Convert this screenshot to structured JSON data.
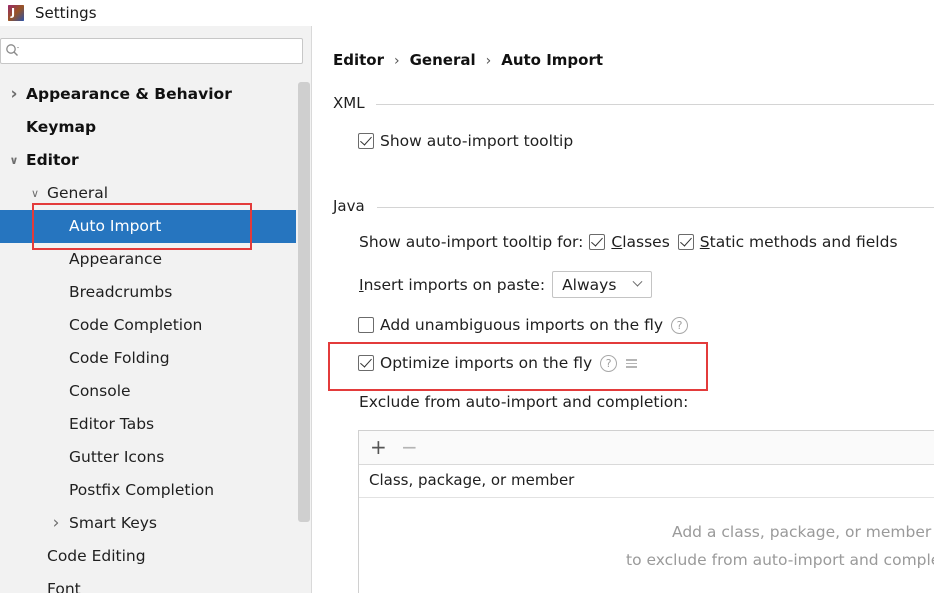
{
  "window": {
    "title": "Settings",
    "app_icon_letter": "J"
  },
  "search": {
    "placeholder": "",
    "value": ""
  },
  "tree": [
    {
      "label": "Appearance & Behavior",
      "bold": true,
      "indent": 0,
      "chevron": "collapsed",
      "name": "tree-item-appearance-behavior"
    },
    {
      "label": "Keymap",
      "bold": true,
      "indent": 0,
      "chevron": "none",
      "name": "tree-item-keymap"
    },
    {
      "label": "Editor",
      "bold": true,
      "indent": 0,
      "chevron": "expanded",
      "name": "tree-item-editor"
    },
    {
      "label": "General",
      "bold": false,
      "indent": 1,
      "chevron": "expanded",
      "name": "tree-item-general"
    },
    {
      "label": "Auto Import",
      "bold": false,
      "indent": 2,
      "chevron": "none",
      "selected": true,
      "name": "tree-item-auto-import"
    },
    {
      "label": "Appearance",
      "bold": false,
      "indent": 2,
      "chevron": "none",
      "name": "tree-item-appearance"
    },
    {
      "label": "Breadcrumbs",
      "bold": false,
      "indent": 2,
      "chevron": "none",
      "name": "tree-item-breadcrumbs"
    },
    {
      "label": "Code Completion",
      "bold": false,
      "indent": 2,
      "chevron": "none",
      "name": "tree-item-code-completion"
    },
    {
      "label": "Code Folding",
      "bold": false,
      "indent": 2,
      "chevron": "none",
      "name": "tree-item-code-folding"
    },
    {
      "label": "Console",
      "bold": false,
      "indent": 2,
      "chevron": "none",
      "name": "tree-item-console"
    },
    {
      "label": "Editor Tabs",
      "bold": false,
      "indent": 2,
      "chevron": "none",
      "name": "tree-item-editor-tabs"
    },
    {
      "label": "Gutter Icons",
      "bold": false,
      "indent": 2,
      "chevron": "none",
      "name": "tree-item-gutter-icons"
    },
    {
      "label": "Postfix Completion",
      "bold": false,
      "indent": 2,
      "chevron": "none",
      "name": "tree-item-postfix-completion"
    },
    {
      "label": "Smart Keys",
      "bold": false,
      "indent": 2,
      "chevron": "collapsed",
      "name": "tree-item-smart-keys"
    },
    {
      "label": "Code Editing",
      "bold": false,
      "indent": 1,
      "chevron": "none",
      "name": "tree-item-code-editing"
    },
    {
      "label": "Font",
      "bold": false,
      "indent": 1,
      "chevron": "none",
      "name": "tree-item-font"
    }
  ],
  "breadcrumb": {
    "items": [
      "Editor",
      "General",
      "Auto Import"
    ],
    "separator": "›"
  },
  "xml": {
    "section_label": "XML",
    "show_tooltip_label": "Show auto-import tooltip",
    "show_tooltip_checked": true
  },
  "java": {
    "section_label": "Java",
    "tooltip_for_label": "Show auto-import tooltip for:",
    "classes_prefix": "",
    "classes_mnemonic": "C",
    "classes_rest": "lasses",
    "classes_checked": true,
    "static_mnemonic": "S",
    "static_rest": "tatic methods and fields",
    "static_checked": true,
    "insert_mnemonic": "I",
    "insert_rest": "nsert imports on paste:",
    "insert_value": "Always",
    "add_unambiguous_label": "Add unambiguous imports on the fly",
    "add_unambiguous_checked": false,
    "optimize_label": "Optimize imports on the fly",
    "optimize_checked": true,
    "exclude_label": "Exclude from auto-import and completion:",
    "table": {
      "add_glyph": "+",
      "remove_glyph": "−",
      "column_header": "Class, package, or member",
      "empty_line1": "Add a class, package, or member",
      "empty_line2": "to exclude from auto-import and completion"
    }
  },
  "colors": {
    "selection": "#2675bf",
    "highlight_box": "#e33b3b"
  }
}
